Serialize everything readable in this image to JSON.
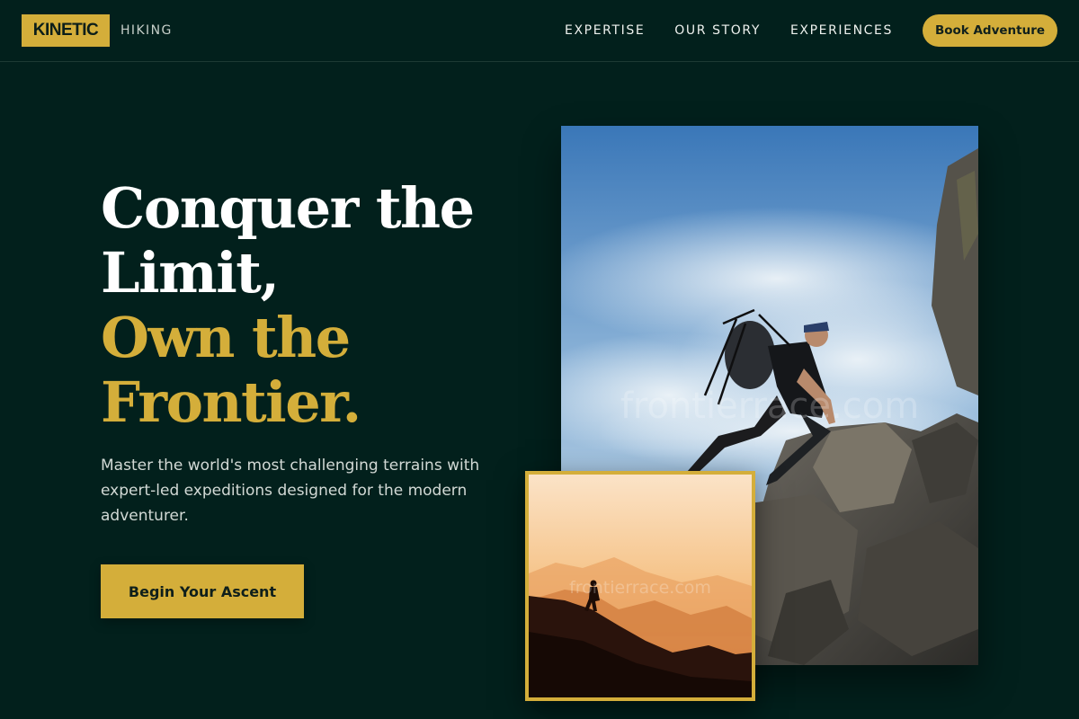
{
  "brand": {
    "name": "KINETIC",
    "tagline": "HIKING"
  },
  "nav": {
    "links": [
      "EXPERTISE",
      "OUR STORY",
      "EXPERIENCES"
    ],
    "cta": "Book Adventure"
  },
  "hero": {
    "headline_white": [
      "Conquer the",
      "Limit,"
    ],
    "headline_gold": [
      "Own the",
      "Frontier."
    ],
    "description": "Master the world's most challenging terrains with expert-led expeditions designed for the modern adventurer.",
    "cta": "Begin Your Ascent"
  },
  "images": {
    "main_watermark": "frontierrace.com",
    "small_watermark": "frontierrace.com"
  },
  "colors": {
    "background": "#02201c",
    "accent": "#d4ae3a",
    "text": "#ffffff"
  }
}
